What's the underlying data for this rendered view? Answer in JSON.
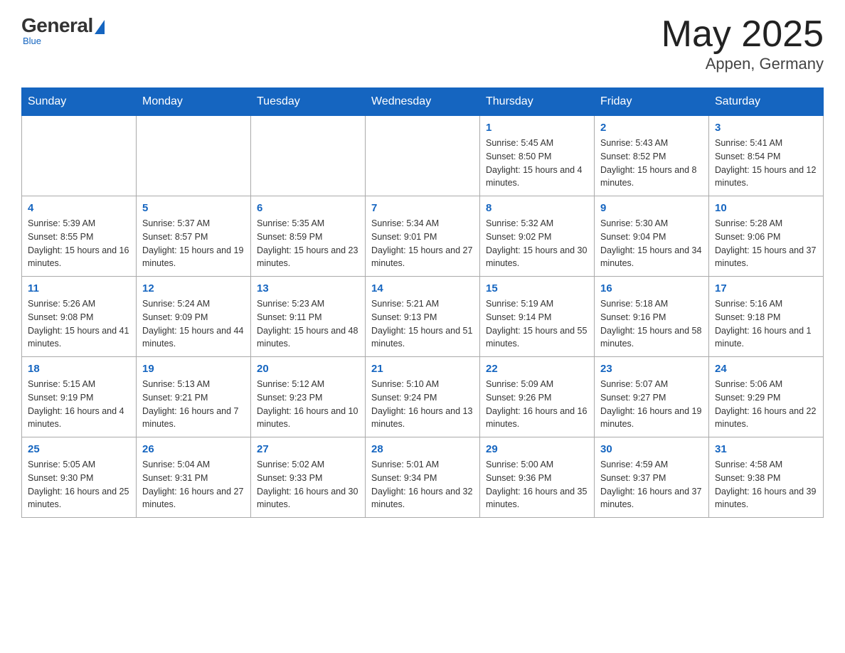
{
  "header": {
    "logo_general": "General",
    "logo_blue": "Blue",
    "logo_subtitle": "Blue",
    "month_year": "May 2025",
    "location": "Appen, Germany"
  },
  "days_of_week": [
    "Sunday",
    "Monday",
    "Tuesday",
    "Wednesday",
    "Thursday",
    "Friday",
    "Saturday"
  ],
  "weeks": [
    [
      {
        "day": "",
        "info": ""
      },
      {
        "day": "",
        "info": ""
      },
      {
        "day": "",
        "info": ""
      },
      {
        "day": "",
        "info": ""
      },
      {
        "day": "1",
        "info": "Sunrise: 5:45 AM\nSunset: 8:50 PM\nDaylight: 15 hours and 4 minutes."
      },
      {
        "day": "2",
        "info": "Sunrise: 5:43 AM\nSunset: 8:52 PM\nDaylight: 15 hours and 8 minutes."
      },
      {
        "day": "3",
        "info": "Sunrise: 5:41 AM\nSunset: 8:54 PM\nDaylight: 15 hours and 12 minutes."
      }
    ],
    [
      {
        "day": "4",
        "info": "Sunrise: 5:39 AM\nSunset: 8:55 PM\nDaylight: 15 hours and 16 minutes."
      },
      {
        "day": "5",
        "info": "Sunrise: 5:37 AM\nSunset: 8:57 PM\nDaylight: 15 hours and 19 minutes."
      },
      {
        "day": "6",
        "info": "Sunrise: 5:35 AM\nSunset: 8:59 PM\nDaylight: 15 hours and 23 minutes."
      },
      {
        "day": "7",
        "info": "Sunrise: 5:34 AM\nSunset: 9:01 PM\nDaylight: 15 hours and 27 minutes."
      },
      {
        "day": "8",
        "info": "Sunrise: 5:32 AM\nSunset: 9:02 PM\nDaylight: 15 hours and 30 minutes."
      },
      {
        "day": "9",
        "info": "Sunrise: 5:30 AM\nSunset: 9:04 PM\nDaylight: 15 hours and 34 minutes."
      },
      {
        "day": "10",
        "info": "Sunrise: 5:28 AM\nSunset: 9:06 PM\nDaylight: 15 hours and 37 minutes."
      }
    ],
    [
      {
        "day": "11",
        "info": "Sunrise: 5:26 AM\nSunset: 9:08 PM\nDaylight: 15 hours and 41 minutes."
      },
      {
        "day": "12",
        "info": "Sunrise: 5:24 AM\nSunset: 9:09 PM\nDaylight: 15 hours and 44 minutes."
      },
      {
        "day": "13",
        "info": "Sunrise: 5:23 AM\nSunset: 9:11 PM\nDaylight: 15 hours and 48 minutes."
      },
      {
        "day": "14",
        "info": "Sunrise: 5:21 AM\nSunset: 9:13 PM\nDaylight: 15 hours and 51 minutes."
      },
      {
        "day": "15",
        "info": "Sunrise: 5:19 AM\nSunset: 9:14 PM\nDaylight: 15 hours and 55 minutes."
      },
      {
        "day": "16",
        "info": "Sunrise: 5:18 AM\nSunset: 9:16 PM\nDaylight: 15 hours and 58 minutes."
      },
      {
        "day": "17",
        "info": "Sunrise: 5:16 AM\nSunset: 9:18 PM\nDaylight: 16 hours and 1 minute."
      }
    ],
    [
      {
        "day": "18",
        "info": "Sunrise: 5:15 AM\nSunset: 9:19 PM\nDaylight: 16 hours and 4 minutes."
      },
      {
        "day": "19",
        "info": "Sunrise: 5:13 AM\nSunset: 9:21 PM\nDaylight: 16 hours and 7 minutes."
      },
      {
        "day": "20",
        "info": "Sunrise: 5:12 AM\nSunset: 9:23 PM\nDaylight: 16 hours and 10 minutes."
      },
      {
        "day": "21",
        "info": "Sunrise: 5:10 AM\nSunset: 9:24 PM\nDaylight: 16 hours and 13 minutes."
      },
      {
        "day": "22",
        "info": "Sunrise: 5:09 AM\nSunset: 9:26 PM\nDaylight: 16 hours and 16 minutes."
      },
      {
        "day": "23",
        "info": "Sunrise: 5:07 AM\nSunset: 9:27 PM\nDaylight: 16 hours and 19 minutes."
      },
      {
        "day": "24",
        "info": "Sunrise: 5:06 AM\nSunset: 9:29 PM\nDaylight: 16 hours and 22 minutes."
      }
    ],
    [
      {
        "day": "25",
        "info": "Sunrise: 5:05 AM\nSunset: 9:30 PM\nDaylight: 16 hours and 25 minutes."
      },
      {
        "day": "26",
        "info": "Sunrise: 5:04 AM\nSunset: 9:31 PM\nDaylight: 16 hours and 27 minutes."
      },
      {
        "day": "27",
        "info": "Sunrise: 5:02 AM\nSunset: 9:33 PM\nDaylight: 16 hours and 30 minutes."
      },
      {
        "day": "28",
        "info": "Sunrise: 5:01 AM\nSunset: 9:34 PM\nDaylight: 16 hours and 32 minutes."
      },
      {
        "day": "29",
        "info": "Sunrise: 5:00 AM\nSunset: 9:36 PM\nDaylight: 16 hours and 35 minutes."
      },
      {
        "day": "30",
        "info": "Sunrise: 4:59 AM\nSunset: 9:37 PM\nDaylight: 16 hours and 37 minutes."
      },
      {
        "day": "31",
        "info": "Sunrise: 4:58 AM\nSunset: 9:38 PM\nDaylight: 16 hours and 39 minutes."
      }
    ]
  ]
}
